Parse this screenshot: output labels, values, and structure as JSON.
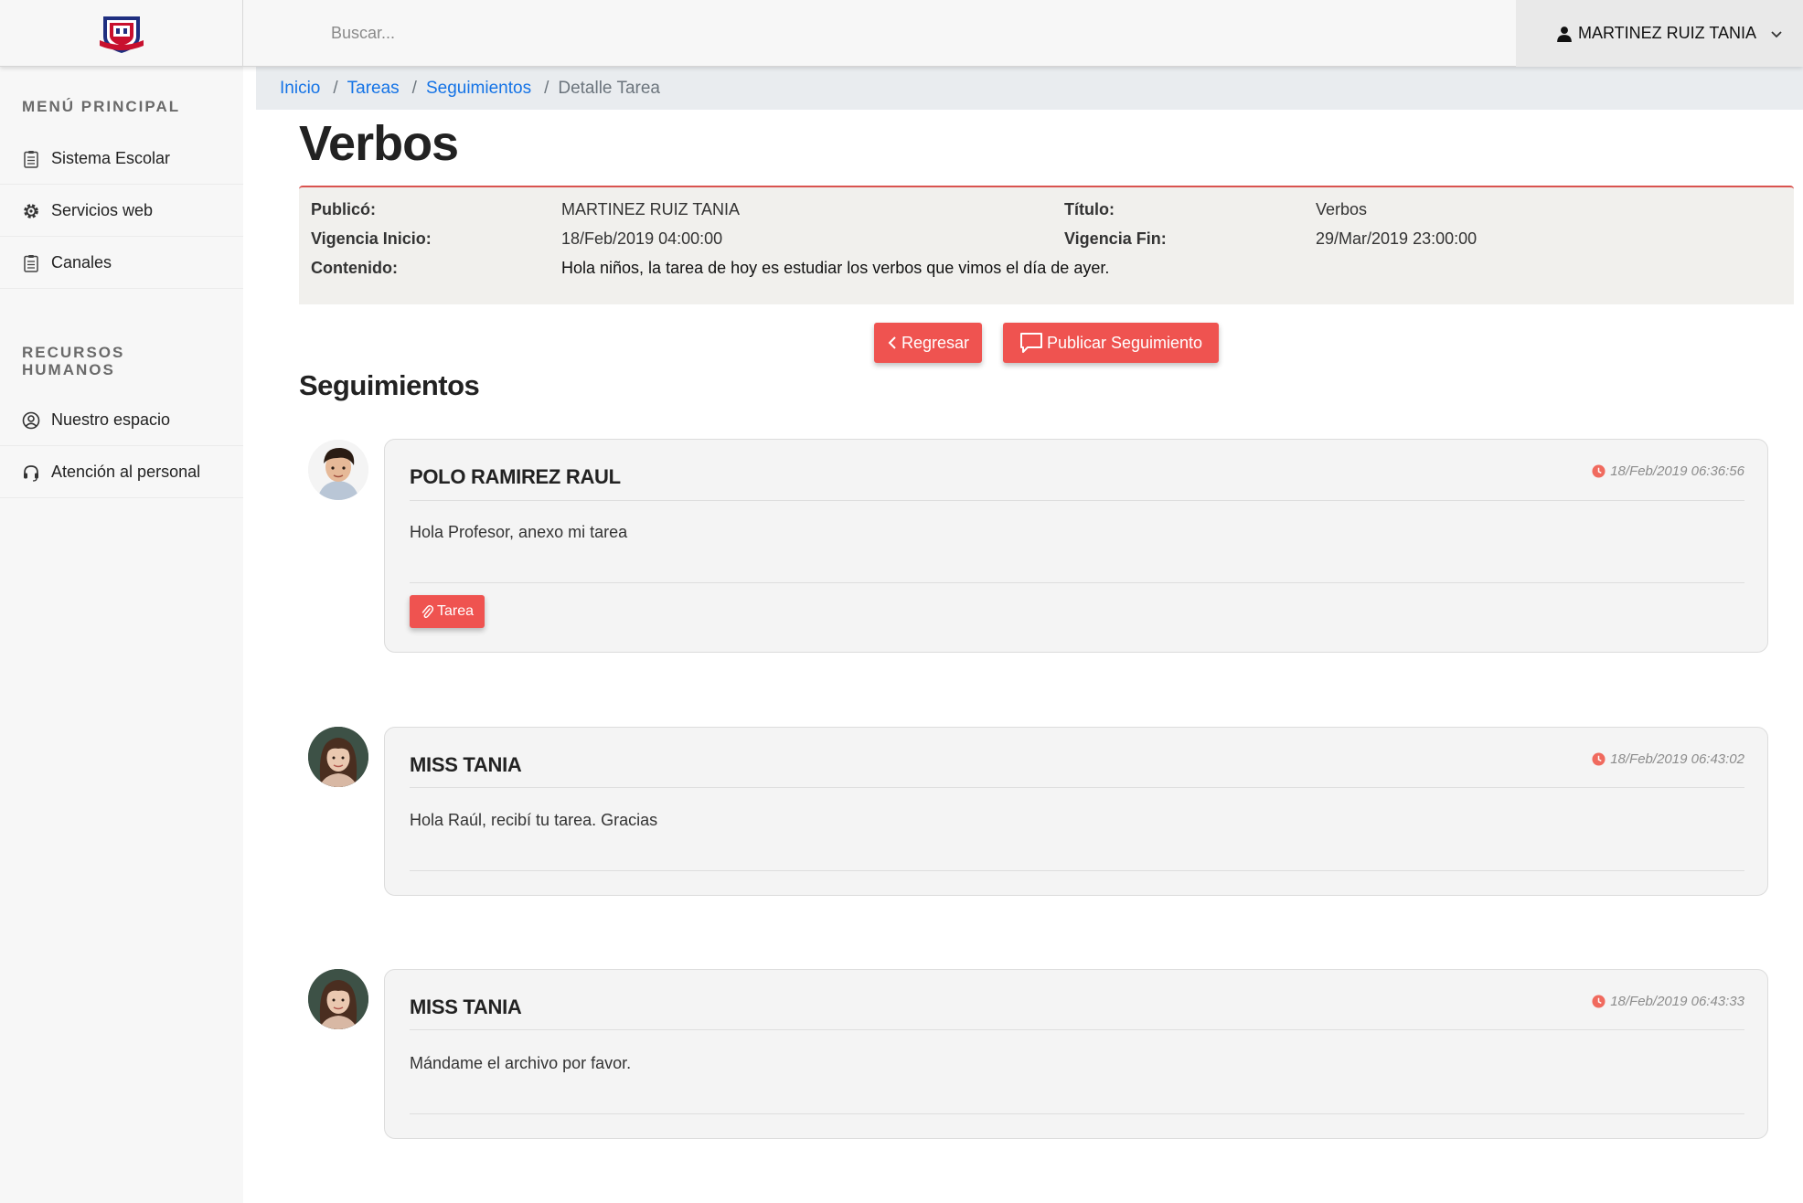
{
  "topbar": {
    "search_placeholder": "Buscar...",
    "user_name": "MARTINEZ RUIZ TANIA"
  },
  "sidebar": {
    "main_menu_title": "MENÚ PRINCIPAL",
    "main_items": [
      {
        "label": "Sistema Escolar",
        "icon": "clipboard-icon"
      },
      {
        "label": "Servicios web",
        "icon": "gear-icon"
      },
      {
        "label": "Canales",
        "icon": "clipboard-icon"
      }
    ],
    "hr_title_line1": "RECURSOS",
    "hr_title_line2": "HUMANOS",
    "hr_items": [
      {
        "label": "Nuestro espacio",
        "icon": "user-circle-icon"
      },
      {
        "label": "Atención al personal",
        "icon": "headset-icon"
      }
    ]
  },
  "breadcrumb": {
    "items": [
      "Inicio",
      "Tareas",
      "Seguimientos"
    ],
    "current": "Detalle Tarea"
  },
  "task": {
    "title": "Verbos",
    "published_by_label": "Publicó:",
    "published_by": "MARTINEZ RUIZ TANIA",
    "title_label": "Título:",
    "title_value": "Verbos",
    "start_label": "Vigencia Inicio:",
    "start": "18/Feb/2019 04:00:00",
    "end_label": "Vigencia Fin:",
    "end": "29/Mar/2019 23:00:00",
    "content_label": "Contenido:",
    "content": "Hola niños, la tarea de hoy es estudiar los verbos que vimos el día de ayer."
  },
  "actions": {
    "back_label": "Regresar",
    "publish_label": "Publicar Seguimiento"
  },
  "followups_title": "Seguimientos",
  "followups": [
    {
      "author": "POLO RAMIREZ RAUL",
      "time": "18/Feb/2019 06:36:56",
      "message": "Hola Profesor, anexo mi tarea",
      "attachment": "Tarea"
    },
    {
      "author": "MISS TANIA",
      "time": "18/Feb/2019 06:43:02",
      "message": "Hola Raúl, recibí tu tarea. Gracias"
    },
    {
      "author": "MISS TANIA",
      "time": "18/Feb/2019 06:43:33",
      "message": "Mándame el archivo por favor."
    }
  ],
  "colors": {
    "accent": "#ef5350",
    "link": "#1473e6",
    "sidebar_bg": "#f7f7f7"
  }
}
